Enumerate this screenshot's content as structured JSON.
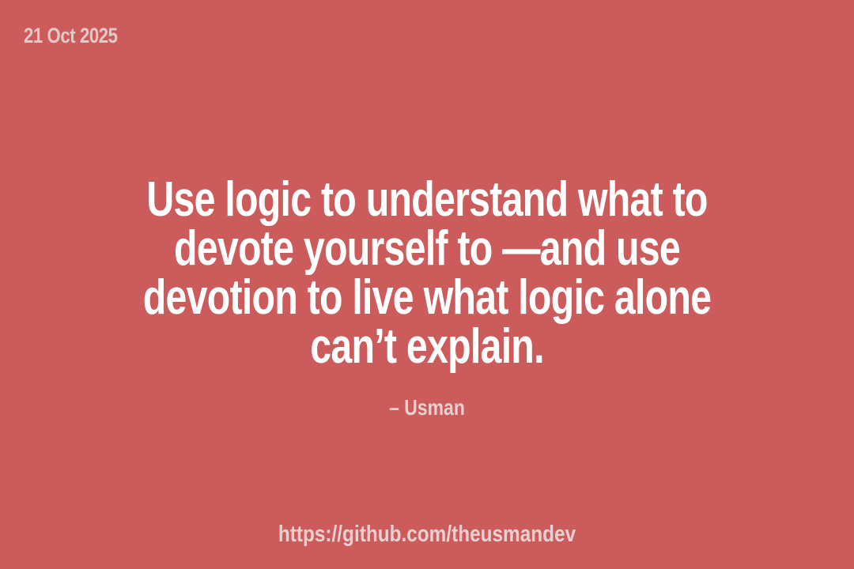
{
  "date": "21 Oct 2025",
  "quote": {
    "lines": [
      "Use logic to understand what to",
      "devote yourself to —and use",
      "devotion to live what logic alone",
      "can’t explain."
    ]
  },
  "author": "– Usman",
  "link": "https://github.com/theusmandev",
  "colors": {
    "background": "#cc5b5b",
    "quote_text": "#ffffff",
    "muted_text": "#e8d0d0"
  }
}
